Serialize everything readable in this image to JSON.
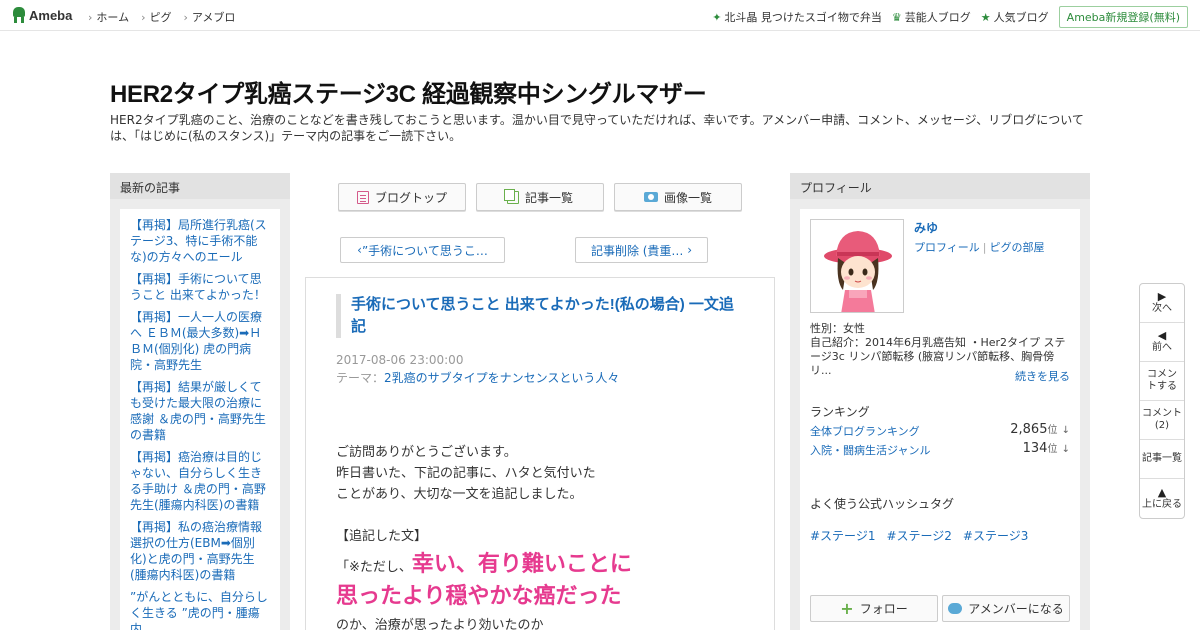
{
  "header": {
    "logo": "Ameba",
    "nav": [
      "ホーム",
      "ピグ",
      "アメブロ"
    ],
    "links": [
      {
        "icon": "sparkle-icon",
        "label": "北斗晶 見つけたスゴイ物で弁当"
      },
      {
        "icon": "crown-icon",
        "label": "芸能人ブログ"
      },
      {
        "icon": "star-icon",
        "label": "人気ブログ"
      }
    ],
    "register": "Ameba新規登録(無料)"
  },
  "blog": {
    "title": "HER2タイプ乳癌ステージ3C 経過観察中シングルマザー",
    "description": "HER2タイプ乳癌のこと、治療のことなどを書き残しておこうと思います。温かい目で見守っていただければ、幸いです。アメンバー申請、コメント、メッセージ、リブログについては、「はじめに(私のスタンス)」テーマ内の記事をご一読下さい。"
  },
  "recent": {
    "heading": "最新の記事",
    "items": [
      "【再掲】局所進行乳癌(ステージ3、特に手術不能な)の方々へのエール",
      "【再掲】手術について思うこと 出来てよかった！",
      "【再掲】一人一人の医療へ ＥＢＭ(最大多数)➡ＨＢＭ(個別化) 虎の門病院・高野先生",
      "【再掲】結果が厳しくても受けた最大限の治療に感謝 ＆虎の門・高野先生の書籍",
      "【再掲】癌治療は目的じゃない、自分らしく生きる手助け ＆虎の門・高野先生(腫瘍内科医)の書籍",
      "【再掲】私の癌治療情報選択の仕方(EBM➡個別化)と虎の門・高野先生(腫瘍内科医)の書籍",
      "”がんとともに、自分らしく生きる ”虎の門・腫瘍内"
    ]
  },
  "toolbar": {
    "blog_top": "ブログトップ",
    "article_list": "記事一覧",
    "image_list": "画像一覧"
  },
  "pager": {
    "prev": "”手術について思うこ…",
    "next": "記事削除 (貴重…"
  },
  "article": {
    "title": "手術について思うこと 出来てよかった!(私の場合) 一文追記",
    "date": "2017-08-06 23:00:00",
    "theme_label": "テーマ：",
    "theme": "2乳癌のサブタイプをナンセンスという人々",
    "p1": "ご訪問ありがとうございます。",
    "p2": "昨日書いた、下記の記事に、ハタと気付いた",
    "p3": "ことがあり、大切な一文を追記しました。",
    "p4": "【追記した文】",
    "quote_prefix": "「※ただし、",
    "big1": "幸い、有り難いことに",
    "big2": "思ったより穏やかな癌だった",
    "p5": "のか、治療が思ったより効いたのか"
  },
  "profile": {
    "heading": "プロフィール",
    "name": "みゆ",
    "link_profile": "プロフィール",
    "link_pig": "ピグの部屋",
    "gender": "性別：女性",
    "intro": "自己紹介：2014年6月乳癌告知 ・Her2タイプ ステージ3c リンパ節転移 (腋窩リンパ節転移、胸骨傍リ...",
    "more": "続きを見る",
    "ranking_heading": "ランキング",
    "rankings": [
      {
        "label": "全体ブログランキング",
        "value": "2,865",
        "unit": "位",
        "trend": "↓"
      },
      {
        "label": "入院・闘病生活ジャンル",
        "value": "134",
        "unit": "位",
        "trend": "↓"
      }
    ],
    "hashtag_heading": "よく使う公式ハッシュタグ",
    "hashtags": [
      "#ステージ1",
      "#ステージ2",
      "#ステージ3"
    ],
    "follow": "フォロー",
    "amember": "アメンバーになる"
  },
  "floatnav": {
    "next": "次へ",
    "prev": "前へ",
    "comment": "コメントする",
    "comments_label": "コメント",
    "comments_count": "(2)",
    "list": "記事一覧",
    "top": "上に戻る"
  },
  "colors": {
    "link": "#1a6bb8",
    "accent_green": "#2d8c3c",
    "highlight_pink": "#e63a8f"
  }
}
